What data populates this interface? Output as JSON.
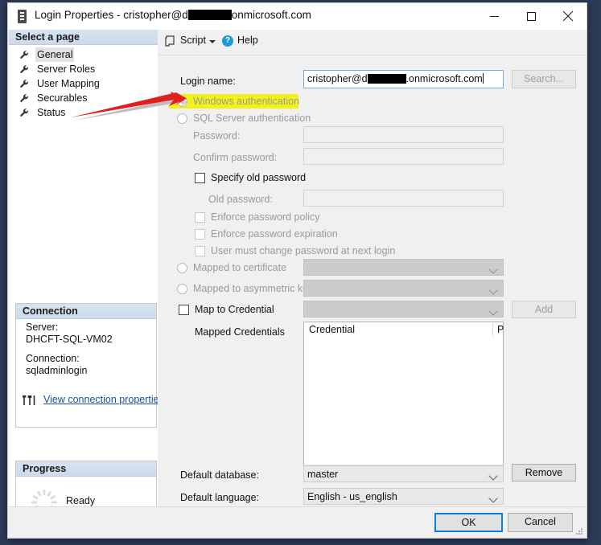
{
  "window": {
    "title_prefix": "Login Properties - cristopher@d",
    "title_suffix": "onmicrosoft.com",
    "icon": "server-icon",
    "minimize_label": "Minimize",
    "maximize_label": "Maximize",
    "close_label": "Close"
  },
  "sidebar": {
    "header": "Select a page",
    "items": [
      {
        "label": "General",
        "selected": true
      },
      {
        "label": "Server Roles",
        "selected": false
      },
      {
        "label": "User Mapping",
        "selected": false
      },
      {
        "label": "Securables",
        "selected": false
      },
      {
        "label": "Status",
        "selected": false
      }
    ],
    "connection": {
      "header": "Connection",
      "server_label": "Server:",
      "server_value": "DHCFT-SQL-VM02",
      "connection_label": "Connection:",
      "connection_value": "sqladminlogin",
      "link": "View connection properties"
    },
    "progress": {
      "header": "Progress",
      "status": "Ready"
    }
  },
  "toolbar": {
    "script_label": "Script",
    "script_caret": "chevron-down-icon",
    "help_label": "Help",
    "help_glyph": "?"
  },
  "form": {
    "login_name_label": "Login name:",
    "login_name_value_prefix": "cristopher@d",
    "login_name_value_suffix": ".onmicrosoft.com",
    "search_button": "Search...",
    "windows_auth": "Windows authentication",
    "sql_auth": "SQL Server authentication",
    "password_label": "Password:",
    "confirm_password_label": "Confirm password:",
    "specify_old_password": "Specify old password",
    "old_password_label": "Old password:",
    "enforce_password_policy": "Enforce password policy",
    "enforce_password_expiration": "Enforce password expiration",
    "must_change_password": "User must change password at next login",
    "mapped_to_certificate": "Mapped to certificate",
    "mapped_to_asymmetric_key": "Mapped to asymmetric key",
    "map_to_credential": "Map to Credential",
    "add_button": "Add",
    "mapped_credentials_label": "Mapped Credentials",
    "credentials_col1": "Credential",
    "credentials_col2": "P",
    "remove_button": "Remove",
    "default_database_label": "Default database:",
    "default_database_value": "master",
    "default_language_label": "Default language:",
    "default_language_value": "English - us_english"
  },
  "footer": {
    "ok_button": "OK",
    "cancel_button": "Cancel"
  },
  "annotation": {
    "arrow": "red-arrow-pointing-right",
    "highlight_color": "#f2f21b",
    "arrow_color": "#e02020"
  }
}
